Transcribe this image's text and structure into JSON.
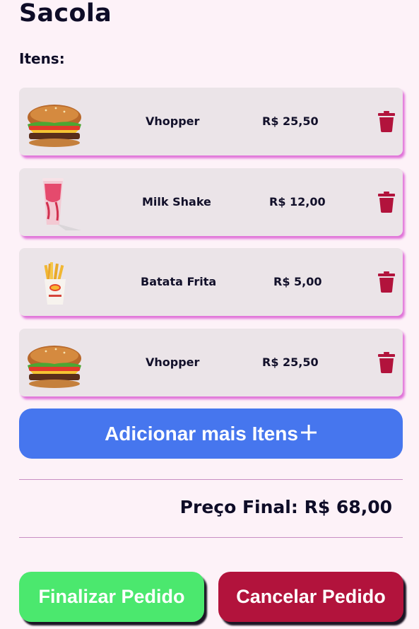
{
  "page": {
    "title": "Sacola",
    "items_label": "Itens:"
  },
  "cart": {
    "items": [
      {
        "name": "Vhopper",
        "price": "R$ 25,50",
        "image": "burger-icon"
      },
      {
        "name": "Milk Shake",
        "price": "R$ 12,00",
        "image": "milkshake-icon"
      },
      {
        "name": "Batata Frita",
        "price": "R$ 5,00",
        "image": "fries-icon"
      },
      {
        "name": "Vhopper",
        "price": "R$ 25,50",
        "image": "burger-icon"
      }
    ],
    "delete_icon": "trash-icon"
  },
  "actions": {
    "add_more_label": "Adicionar mais Itens",
    "add_icon": "plus-icon",
    "total_text": "Preço Final: R$ 68,00",
    "finish_label": "Finalizar Pedido",
    "cancel_label": "Cancelar Pedido"
  },
  "colors": {
    "background": "#fdf2f8",
    "card": "#ebe4e8",
    "card_shadow": "#e074d9",
    "add_button": "#4676ee",
    "finish_button": "#4be86e",
    "cancel_button": "#b2133c",
    "trash": "#b2133c"
  }
}
